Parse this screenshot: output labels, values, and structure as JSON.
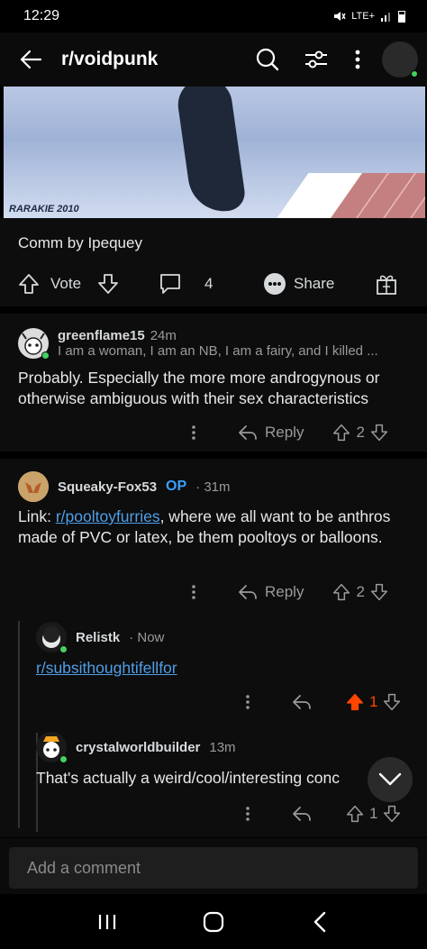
{
  "status": {
    "time": "12:29",
    "network": "LTE+"
  },
  "header": {
    "subreddit": "r/voidpunk"
  },
  "post": {
    "image_signature": "RARAKIE 2010",
    "caption": "Comm by Ipequey",
    "vote_label": "Vote",
    "comment_count": "4",
    "share_label": "Share"
  },
  "comments": [
    {
      "username": "greenflame15",
      "time": "24m",
      "flair": "I am a woman, I am an NB, I am a fairy, and I killed ...",
      "text": "Probably. Especially the more more androgynous or otherwise ambiguous with their sex characteristics",
      "reply_label": "Reply",
      "score": "2"
    },
    {
      "username": "Squeaky-Fox53",
      "op_badge": "OP",
      "time": "· 31m",
      "text_prefix": "Link: ",
      "link": "r/pooltoyfurries",
      "text_suffix": ", where we all want to be anthros made of PVC or latex, be them pooltoys or balloons.",
      "reply_label": "Reply",
      "score": "2"
    },
    {
      "username": "Relistk",
      "time": "· Now",
      "link": "r/subsithoughtifellfor",
      "score": "1"
    },
    {
      "username": "crystalworldbuilder",
      "time": "13m",
      "text": "That's actually a weird/cool/interesting conc",
      "score": "1"
    }
  ],
  "comment_bar": {
    "placeholder": "Add a comment"
  },
  "colors": {
    "upvote_active": "#ff4500",
    "link": "#4f9fe8",
    "op": "#3aa0ff",
    "online": "#46d160"
  }
}
